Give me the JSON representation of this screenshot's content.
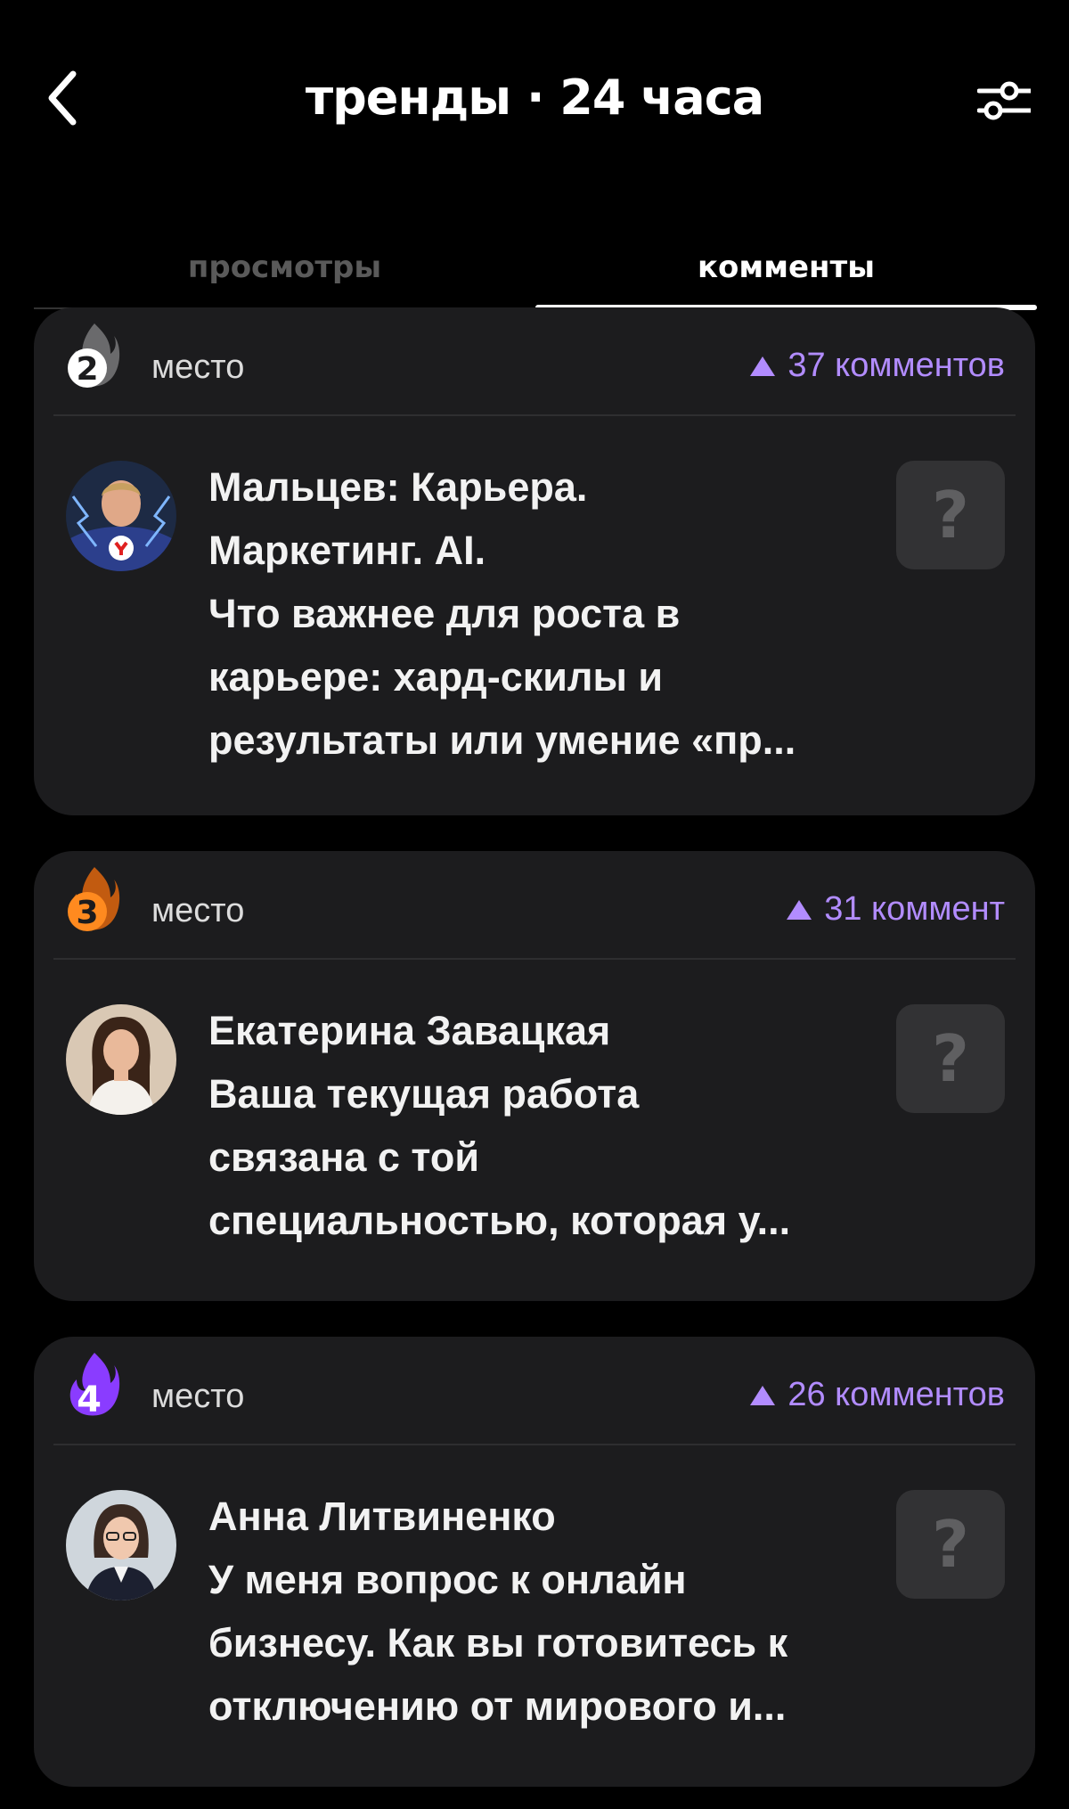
{
  "header": {
    "title": "тренды · 24 часа",
    "back_icon": "chevron-left-icon",
    "filter_icon": "sliders-icon"
  },
  "tabs": [
    {
      "label": "просмотры",
      "active": false
    },
    {
      "label": "комменты",
      "active": true
    }
  ],
  "colors": {
    "background": "#000000",
    "card": "#1c1c1e",
    "accent": "#b28cff",
    "rank2": "#ffffff",
    "rank3": "#ff8a1f",
    "rank4": "#8a3cff"
  },
  "cards": [
    {
      "rank": "2",
      "place_label": "место",
      "comments": "37 комментов",
      "lines": [
        "Мальцев: Карьера.",
        "Маркетинг. AI.",
        "Что важнее для роста в",
        "карьере: хард-скилы и",
        "результаты или умение «пр..."
      ],
      "placeholder_symbol": "?"
    },
    {
      "rank": "3",
      "place_label": "место",
      "comments": "31 коммент",
      "lines": [
        "Екатерина Завацкая",
        "Ваша текущая работа",
        "связана с той",
        "специальностью, которая у..."
      ],
      "placeholder_symbol": "?"
    },
    {
      "rank": "4",
      "place_label": "место",
      "comments": "26 комментов",
      "lines": [
        "Анна Литвиненко",
        "У меня вопрос к онлайн",
        "бизнесу. Как вы готовитесь к",
        "отключению от мирового и..."
      ],
      "placeholder_symbol": "?"
    }
  ]
}
